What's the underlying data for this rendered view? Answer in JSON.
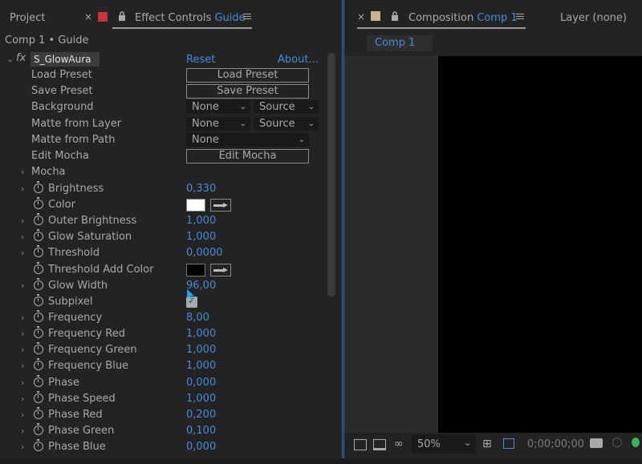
{
  "left_panel": {
    "tab_project": "Project",
    "tab_effect_controls": "Effect Controls",
    "tab_effect_controls_target": "Guide",
    "breadcrumb": "Comp 1 • Guide",
    "effect_name": "S_GlowAura",
    "reset_label": "Reset",
    "about_label": "About...",
    "fx_label": "fx"
  },
  "rows": {
    "load_preset": {
      "label": "Load Preset",
      "button": "Load Preset"
    },
    "save_preset": {
      "label": "Save Preset",
      "button": "Save Preset"
    },
    "background": {
      "label": "Background",
      "dd1": "None",
      "dd2": "Source"
    },
    "matte_layer": {
      "label": "Matte from Layer",
      "dd1": "None",
      "dd2": "Source"
    },
    "matte_path": {
      "label": "Matte from Path",
      "dd1": "None"
    },
    "edit_mocha": {
      "label": "Edit Mocha",
      "button": "Edit Mocha"
    },
    "mocha": {
      "label": "Mocha"
    },
    "brightness": {
      "label": "Brightness",
      "value": "0,330"
    },
    "color": {
      "label": "Color",
      "swatch": "#ffffff"
    },
    "outer_brightness": {
      "label": "Outer Brightness",
      "value": "1,000"
    },
    "glow_saturation": {
      "label": "Glow Saturation",
      "value": "1,000"
    },
    "threshold": {
      "label": "Threshold",
      "value": "0,0000"
    },
    "threshold_add_color": {
      "label": "Threshold Add Color",
      "swatch": "#000000"
    },
    "glow_width": {
      "label": "Glow Width",
      "value": "96,00"
    },
    "subpixel": {
      "label": "Subpixel",
      "checked": true
    },
    "frequency": {
      "label": "Frequency",
      "value": "8,00"
    },
    "frequency_red": {
      "label": "Frequency Red",
      "value": "1,000"
    },
    "frequency_green": {
      "label": "Frequency Green",
      "value": "1,000"
    },
    "frequency_blue": {
      "label": "Frequency Blue",
      "value": "1,000"
    },
    "phase": {
      "label": "Phase",
      "value": "0,000"
    },
    "phase_speed": {
      "label": "Phase Speed",
      "value": "1,000"
    },
    "phase_red": {
      "label": "Phase Red",
      "value": "0,200"
    },
    "phase_green": {
      "label": "Phase Green",
      "value": "0,100"
    },
    "phase_blue": {
      "label": "Phase Blue",
      "value": "0,000"
    }
  },
  "right_panel": {
    "tab_composition": "Composition",
    "tab_composition_target": "Comp 1",
    "tab_layer": "Layer",
    "tab_layer_target": "(none)",
    "subtab": "Comp 1",
    "zoom": "50%",
    "timecode": "0;00;00;00"
  },
  "colors": {
    "accent_blue": "#4a8ad9",
    "effect_label_red": "#c8343d",
    "comp_icon": "#c9b48a"
  }
}
